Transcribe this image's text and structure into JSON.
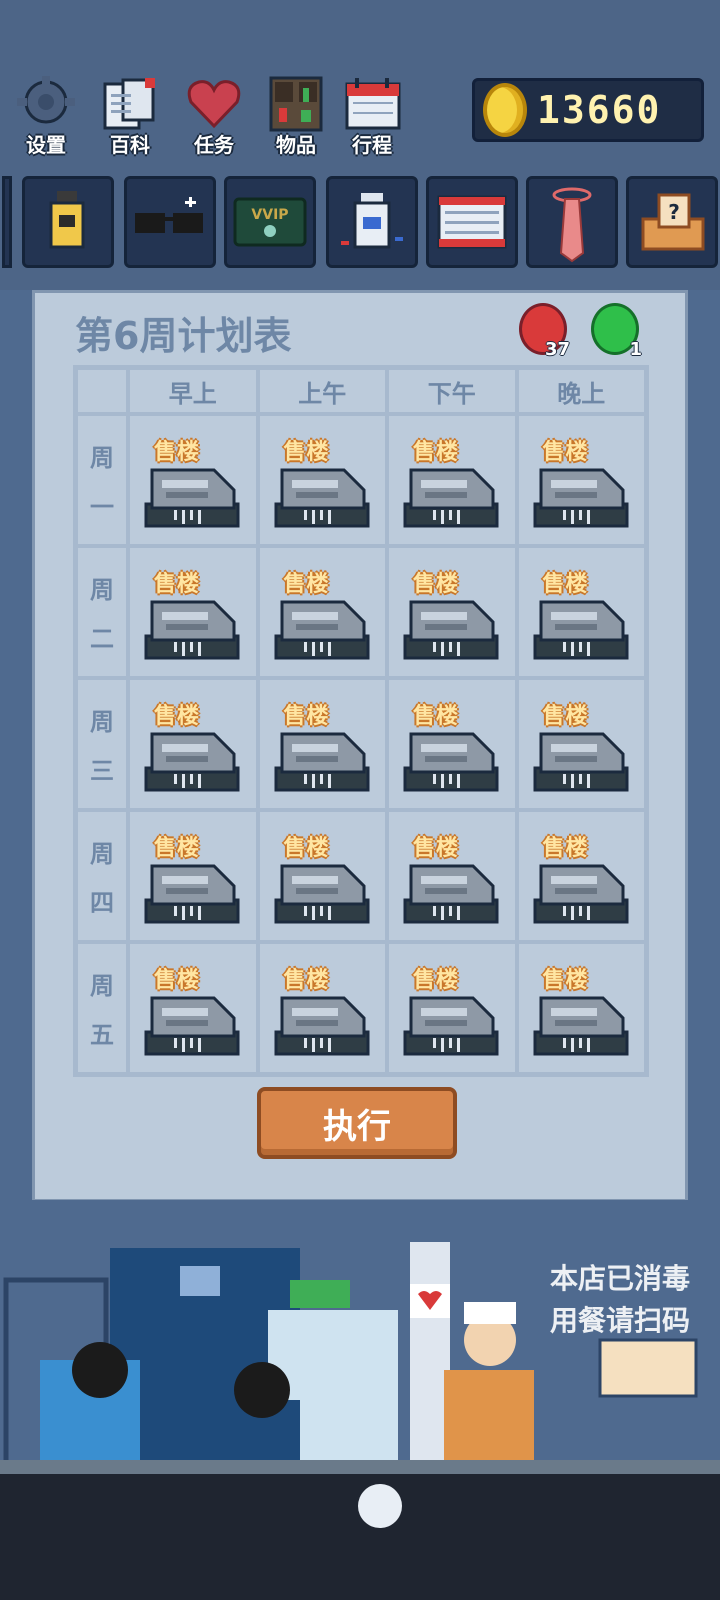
{
  "menu": [
    {
      "label": "设置",
      "icon": "gear-icon"
    },
    {
      "label": "百科",
      "icon": "encyclopedia-icon"
    },
    {
      "label": "任务",
      "icon": "heart-icon"
    },
    {
      "label": "物品",
      "icon": "shelf-icon"
    },
    {
      "label": "行程",
      "icon": "calendar-icon"
    }
  ],
  "coins": "13660",
  "items": [
    {
      "icon": "perfume-bottle-icon"
    },
    {
      "icon": "sunglasses-icon"
    },
    {
      "icon": "vvip-card-icon",
      "text": "VVIP"
    },
    {
      "icon": "medicine-bottle-icon"
    },
    {
      "icon": "calendar-icon"
    },
    {
      "icon": "necktie-icon"
    },
    {
      "icon": "mystery-box-icon"
    }
  ],
  "schedule": {
    "title": "第6周计划表",
    "red_gems": "37",
    "green_gems": "1",
    "time_slots": [
      "早上",
      "上午",
      "下午",
      "晚上"
    ],
    "days": [
      {
        "l1": "周",
        "l2": "一"
      },
      {
        "l1": "周",
        "l2": "二"
      },
      {
        "l1": "周",
        "l2": "三"
      },
      {
        "l1": "周",
        "l2": "四"
      },
      {
        "l1": "周",
        "l2": "五"
      }
    ],
    "activity": "售楼",
    "execute_label": "执行"
  },
  "scene": {
    "sign_line1": "本店已消毒",
    "sign_line2": "用餐请扫码"
  },
  "colors": {
    "background": "#4f6a8f",
    "panel": "#bccbdb",
    "header_text": "#6e87a6",
    "execute_button": "#d8854a",
    "coin": "#f5d442",
    "red_gem": "#d93a3a",
    "green_gem": "#2fbf4a"
  }
}
